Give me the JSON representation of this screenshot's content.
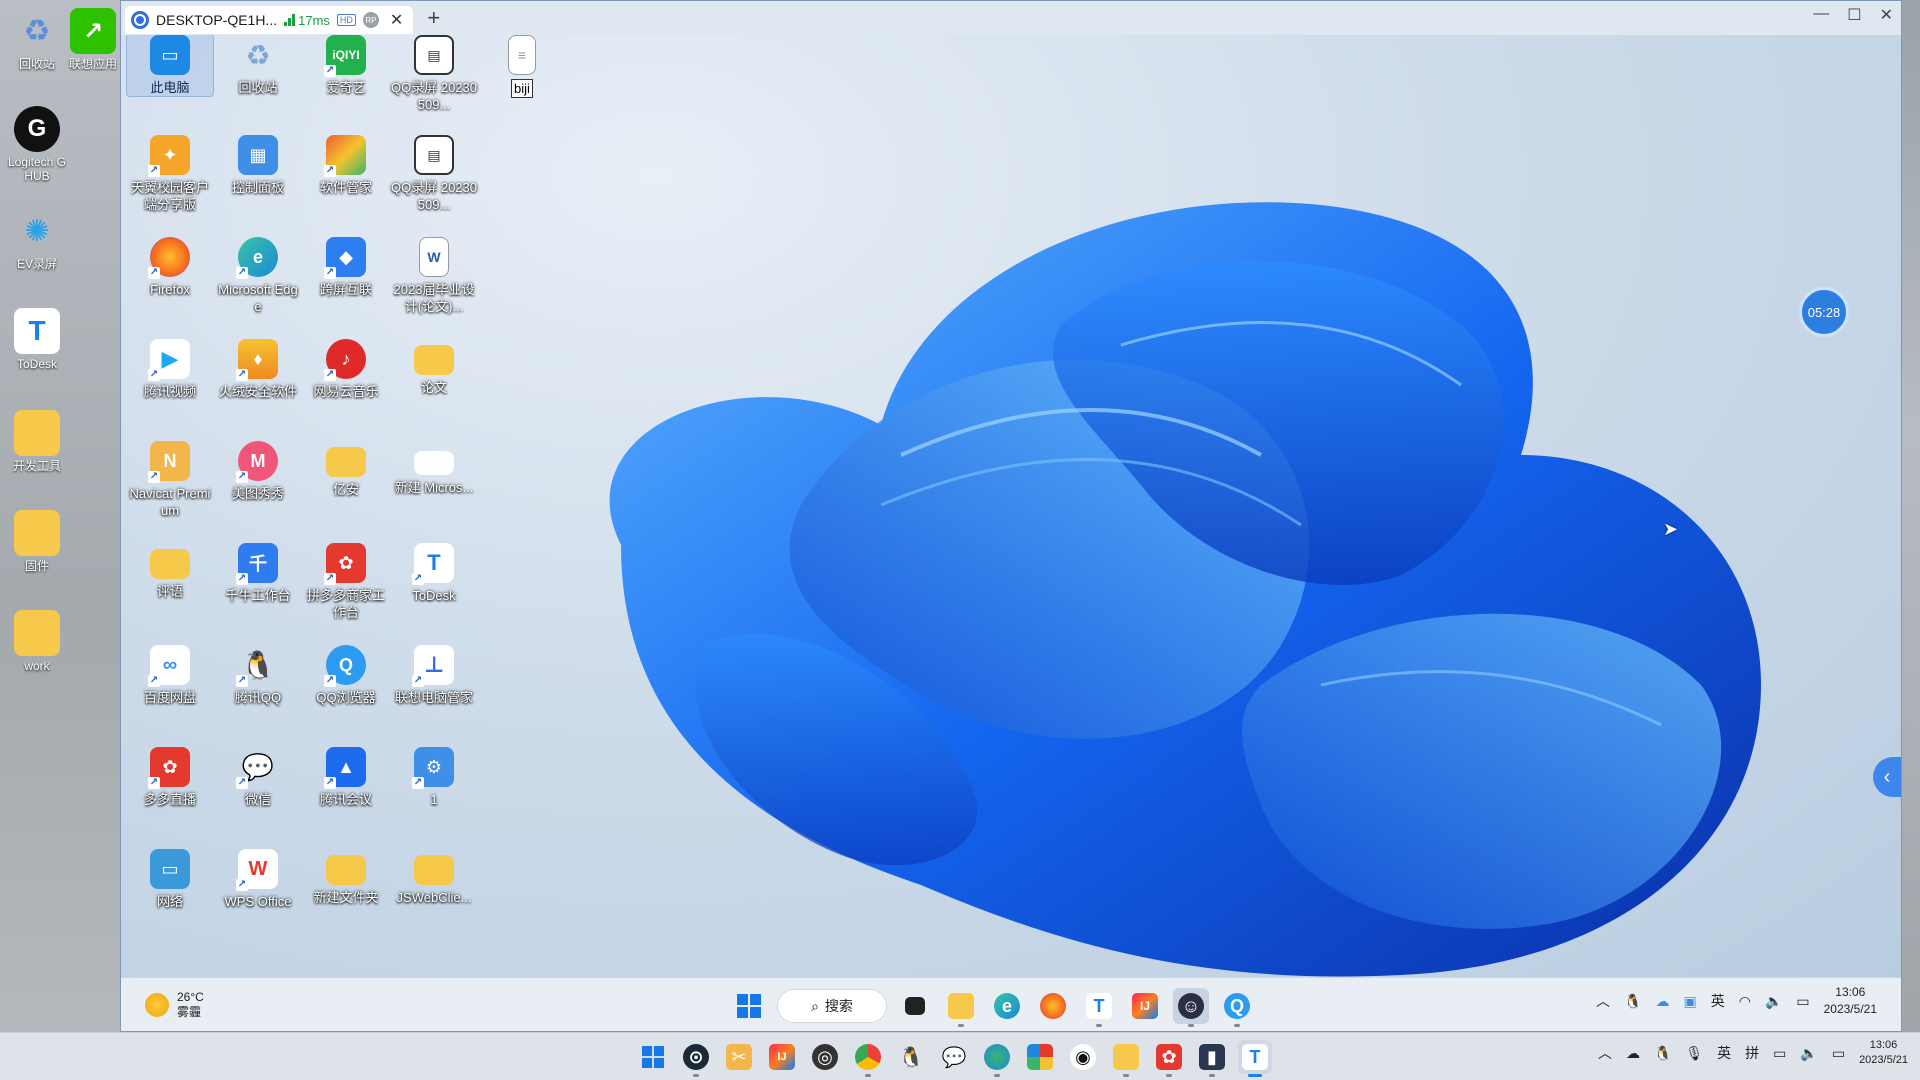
{
  "host": {
    "icons": [
      "回收站",
      "联想应用",
      "Logitech G HUB",
      "EV录屏",
      "ToDesk",
      "开发工具",
      "固件",
      "work"
    ]
  },
  "remote_tab": {
    "title": "DESKTOP-QE1H...",
    "latency": "17ms",
    "hd": "HD",
    "rp": "RP",
    "add": "+"
  },
  "remote_desktop": {
    "icons": [
      {
        "label": "此电脑",
        "icon": "monitor-icon",
        "color": "#1e88e5"
      },
      {
        "label": "回收站",
        "icon": "recycle-bin-icon",
        "color": "#b0bec5"
      },
      {
        "label": "爱奇艺",
        "icon": "iqiyi-icon",
        "color": "#22b14c"
      },
      {
        "label": "QQ录屏 20230509...",
        "icon": "video-file-icon",
        "color": "#333333"
      },
      {
        "label": "biji",
        "icon": "text-file-icon",
        "color": "#ffffff"
      },
      {
        "label": "天翼校园客户端分享版",
        "icon": "tianyi-icon",
        "color": "#f4a52a"
      },
      {
        "label": "控制面板",
        "icon": "control-panel-icon",
        "color": "#3f8ee8"
      },
      {
        "label": "软件管家",
        "icon": "software-manager-icon",
        "color": "#e8612c"
      },
      {
        "label": "QQ录屏 20230509...",
        "icon": "video-file-icon",
        "color": "#333333"
      },
      {
        "label": "Firefox",
        "icon": "firefox-icon",
        "color": "#f76b1c"
      },
      {
        "label": "Microsoft Edge",
        "icon": "edge-icon",
        "color": "#1c8ad6"
      },
      {
        "label": "跨屏互联",
        "icon": "cross-screen-icon",
        "color": "#2d7ef0"
      },
      {
        "label": "2023届毕业设计(论文)...",
        "icon": "word-doc-icon",
        "color": "#2b5fb4"
      },
      {
        "label": "腾讯视频",
        "icon": "tencent-video-icon",
        "color": "#20a8f4"
      },
      {
        "label": "火绒安全软件",
        "icon": "huorong-icon",
        "color": "#f08a24"
      },
      {
        "label": "网易云音乐",
        "icon": "netease-music-icon",
        "color": "#e02a2a"
      },
      {
        "label": "论文",
        "icon": "folder-icon",
        "color": "#f6c94a"
      },
      {
        "label": "Navicat Premium",
        "icon": "navicat-icon",
        "color": "#f2b64a"
      },
      {
        "label": "美图秀秀",
        "icon": "meitu-icon",
        "color": "#f2557a"
      },
      {
        "label": "亿安",
        "icon": "folder-icon",
        "color": "#f6c94a"
      },
      {
        "label": "新建 Micros...",
        "icon": "blank-doc-icon",
        "color": "#ffffff"
      },
      {
        "label": "评语",
        "icon": "folder-icon",
        "color": "#f6c94a"
      },
      {
        "label": "千牛工作台",
        "icon": "qianniu-icon",
        "color": "#2f7cf0"
      },
      {
        "label": "拼多多商家工作台",
        "icon": "pinduoduo-icon",
        "color": "#e3392e"
      },
      {
        "label": "ToDesk",
        "icon": "todesk-icon",
        "color": "#1b7ff0"
      },
      {
        "label": "百度网盘",
        "icon": "baidu-netdisk-icon",
        "color": "#3a8df0"
      },
      {
        "label": "腾讯QQ",
        "icon": "qq-penguin-icon",
        "color": "#111111"
      },
      {
        "label": "QQ浏览器",
        "icon": "qq-browser-icon",
        "color": "#2b9cf2"
      },
      {
        "label": "联想电脑管家",
        "icon": "lenovo-manager-icon",
        "color": "#2f6ee8"
      },
      {
        "label": "多多直播",
        "icon": "duoduo-live-icon",
        "color": "#e3392e"
      },
      {
        "label": "微信",
        "icon": "wechat-icon",
        "color": "#2dc100"
      },
      {
        "label": "腾讯会议",
        "icon": "tencent-meeting-icon",
        "color": "#1f6bf0"
      },
      {
        "label": "1",
        "icon": "settings-shortcut-icon",
        "color": "#3f8ee8"
      },
      {
        "label": "网络",
        "icon": "network-icon",
        "color": "#3a9ad9"
      },
      {
        "label": "WPS Office",
        "icon": "wps-icon",
        "color": "#e3392e"
      },
      {
        "label": "新建文件夹",
        "icon": "folder-icon",
        "color": "#f6c94a"
      },
      {
        "label": "JSWebClie...",
        "icon": "folder-icon",
        "color": "#f6c94a"
      }
    ],
    "timer": "05:28"
  },
  "remote_taskbar": {
    "temperature": "26°C",
    "weather": "雾霾",
    "search_label": "搜索",
    "ime": "英",
    "time": "13:06",
    "date": "2023/5/21"
  },
  "outer_taskbar": {
    "ime1": "英",
    "ime2": "拼",
    "time": "13:06",
    "date": "2023/5/21"
  }
}
